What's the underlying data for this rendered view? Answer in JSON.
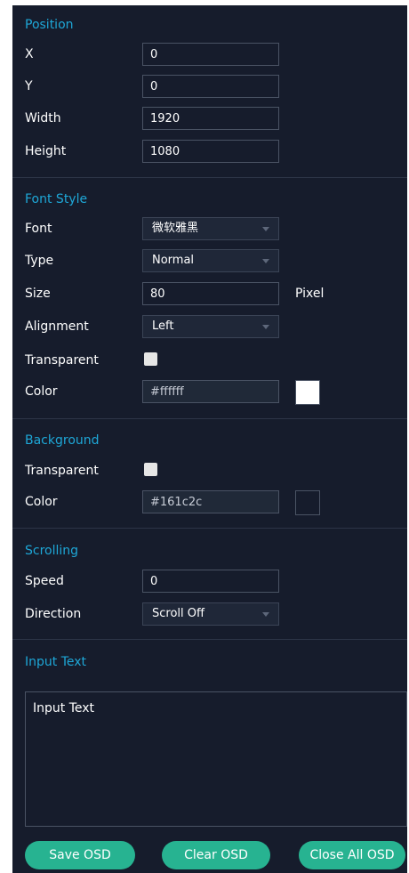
{
  "position": {
    "title": "Position",
    "x": {
      "label": "X",
      "value": "0"
    },
    "y": {
      "label": "Y",
      "value": "0"
    },
    "width": {
      "label": "Width",
      "value": "1920"
    },
    "height": {
      "label": "Height",
      "value": "1080"
    }
  },
  "font_style": {
    "title": "Font Style",
    "font": {
      "label": "Font",
      "value": "微软雅黑"
    },
    "type": {
      "label": "Type",
      "value": "Normal"
    },
    "size": {
      "label": "Size",
      "value": "80",
      "unit": "Pixel"
    },
    "alignment": {
      "label": "Alignment",
      "value": "Left"
    },
    "transparent": {
      "label": "Transparent"
    },
    "color": {
      "label": "Color",
      "value": "#ffffff",
      "swatch": "#ffffff"
    }
  },
  "background": {
    "title": "Background",
    "transparent": {
      "label": "Transparent"
    },
    "color": {
      "label": "Color",
      "value": "#161c2c",
      "swatch": "#161c2c"
    }
  },
  "scrolling": {
    "title": "Scrolling",
    "speed": {
      "label": "Speed",
      "value": "0"
    },
    "direction": {
      "label": "Direction",
      "value": "Scroll Off"
    }
  },
  "input_text": {
    "title": "Input Text",
    "placeholder": "Input Text"
  },
  "buttons": {
    "save": "Save OSD",
    "clear": "Clear OSD",
    "close_all": "Close All OSD"
  },
  "theme": {
    "panel_bg": "#161c2c",
    "accent": "#1ea7d7",
    "button_bg": "#27b391"
  }
}
